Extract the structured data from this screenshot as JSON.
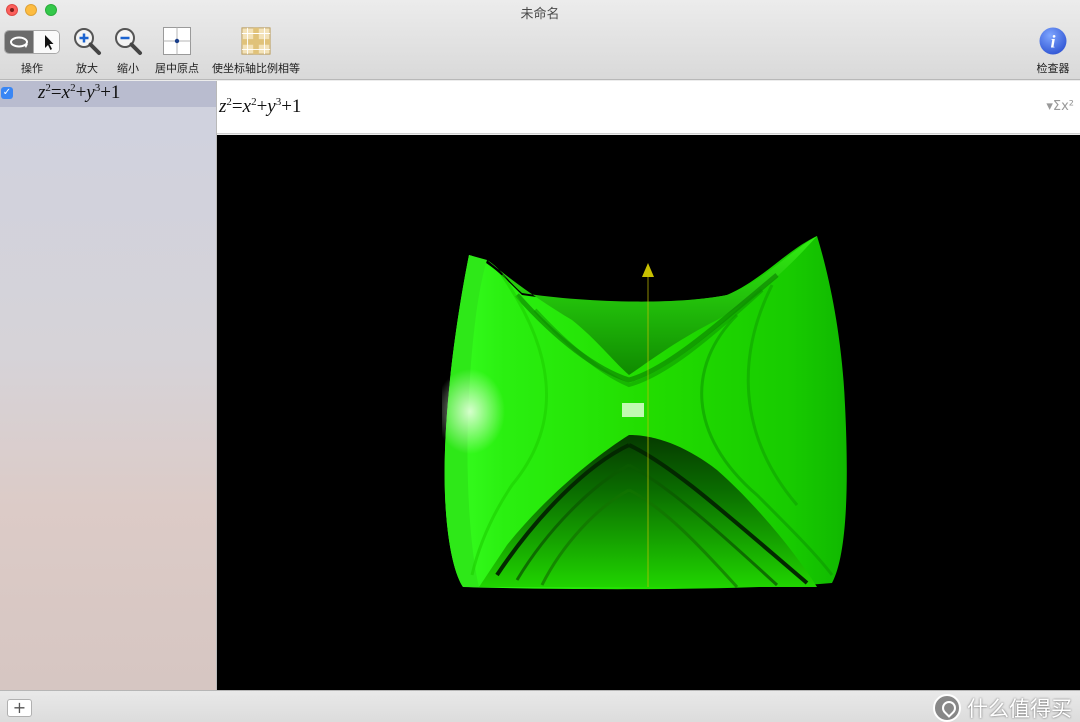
{
  "window": {
    "title": "未命名"
  },
  "toolbar": {
    "action_label": "操作",
    "zoom_in_label": "放大",
    "zoom_out_label": "缩小",
    "center_origin_label": "居中原点",
    "equal_axes_label": "使坐标轴比例相等",
    "inspector_label": "检查器"
  },
  "sidebar": {
    "items": [
      {
        "checked": true,
        "equation": {
          "lhs_var": "z",
          "lhs_exp": "2",
          "x": "x",
          "x_exp": "2",
          "y": "y",
          "y_exp": "3",
          "const": "+1"
        }
      }
    ]
  },
  "editor": {
    "equation": {
      "lhs_var": "z",
      "lhs_exp": "2",
      "x": "x",
      "x_exp": "2",
      "y": "y",
      "y_exp": "3",
      "const": "+1"
    },
    "sigma_button": "▾Σx²"
  },
  "graph": {
    "surface_color": "#22ff00",
    "background": "#000000",
    "axis_color": "#c8c000"
  },
  "bottom": {
    "add_button": "+"
  },
  "watermark": {
    "text": "什么值得买"
  }
}
